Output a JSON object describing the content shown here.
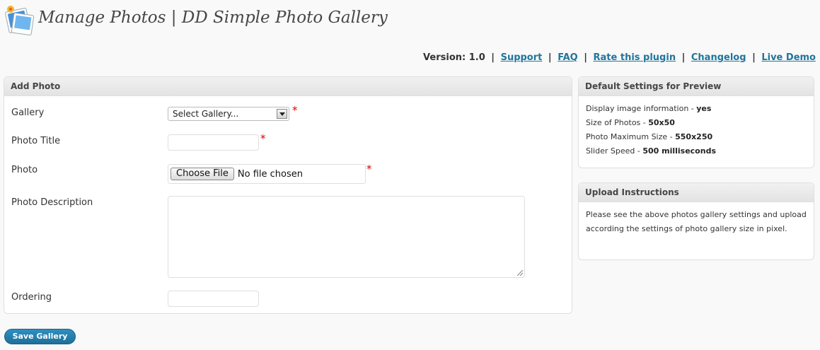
{
  "header": {
    "title": "Manage Photos | DD Simple Photo Gallery",
    "logo_icon": "photo-gallery-icon"
  },
  "version_bar": {
    "version_label": "Version: 1.0",
    "links": [
      "Support",
      "FAQ",
      "Rate this plugin",
      "Changelog",
      "Live Demo"
    ],
    "link_color": "#21759b"
  },
  "add_photo": {
    "title": "Add Photo",
    "gallery_label": "Gallery",
    "gallery_selected": "Select Gallery...",
    "photo_title_label": "Photo Title",
    "photo_title_value": "",
    "photo_label": "Photo",
    "file_button": "Choose File",
    "file_status": "No file chosen",
    "description_label": "Photo Description",
    "description_value": "",
    "ordering_label": "Ordering",
    "ordering_value": "",
    "required_mark": "*"
  },
  "defaults": {
    "title": "Default Settings for Preview",
    "items": [
      {
        "label": "Display image information - ",
        "value": "yes"
      },
      {
        "label": "Size of Photos - ",
        "value": "50x50"
      },
      {
        "label": "Photo Maximum Size - ",
        "value": "550x250"
      },
      {
        "label": "Slider Speed - ",
        "value": "500 milliseconds"
      }
    ]
  },
  "instructions": {
    "title": "Upload Instructions",
    "text": "Please see the above photos gallery settings and upload according the settings of photo gallery size in pixel."
  },
  "actions": {
    "save_label": "Save Gallery",
    "accent_color": "#21759b",
    "required_color": "#dd0000"
  }
}
